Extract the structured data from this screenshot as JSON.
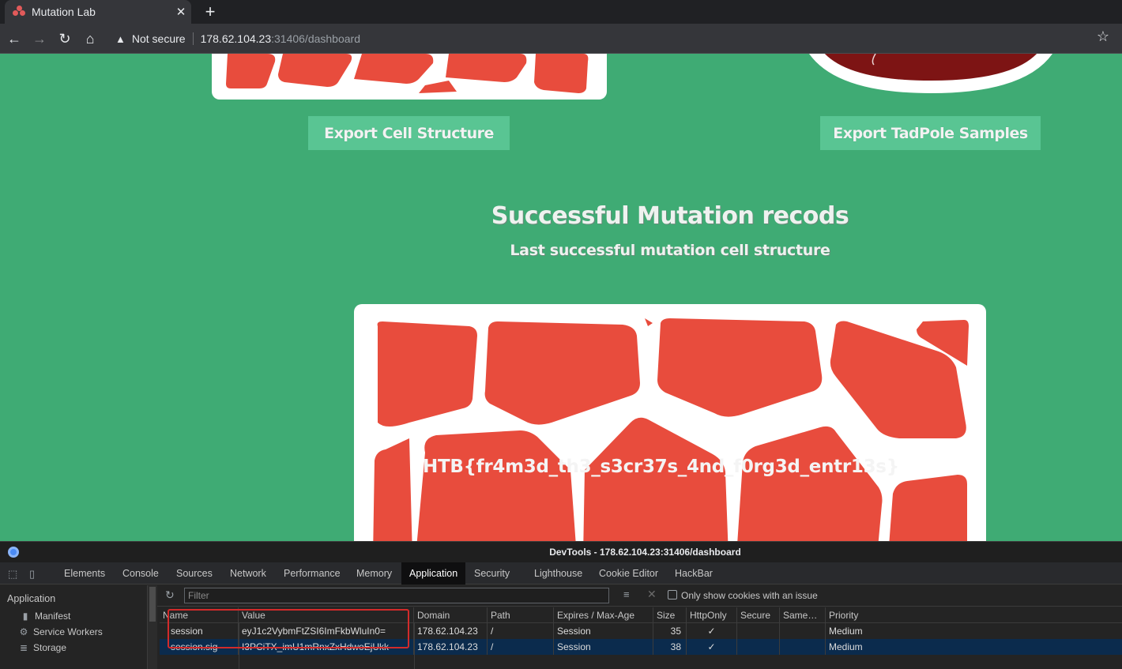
{
  "browser": {
    "tab_title": "Mutation Lab",
    "tab_close": "✕",
    "new_tab": "+",
    "not_secure": "Not secure",
    "url_host": "178.62.104.23",
    "url_rest": ":31406/dashboard"
  },
  "page": {
    "export_cell_label": "Export Cell Structure",
    "export_tadpole_label": "Export TadPole Samples",
    "records_title": "Successful Mutation recods",
    "records_subtitle": "Last successful mutation cell structure",
    "flag_text": "HTB{fr4m3d_th3_s3cr37s_4nd_f0rg3d_entr13s}",
    "colors": {
      "background": "#3fab74",
      "cell": "#e84c3d",
      "button": "#59c593"
    }
  },
  "devtools": {
    "title": "DevTools - 178.62.104.23:31406/dashboard",
    "tabs": [
      "Elements",
      "Console",
      "Sources",
      "Network",
      "Performance",
      "Memory",
      "Application",
      "Security",
      "Lighthouse",
      "Cookie Editor",
      "HackBar"
    ],
    "active_tab": "Application",
    "sidebar": {
      "heading": "Application",
      "items": [
        "Manifest",
        "Service Workers",
        "Storage"
      ]
    },
    "filter_placeholder": "Filter",
    "only_issues_label": "Only show cookies with an issue",
    "columns": [
      "Name",
      "Value",
      "Domain",
      "Path",
      "Expires / Max-Age",
      "Size",
      "HttpOnly",
      "Secure",
      "Same…",
      "Priority"
    ],
    "cookies": [
      {
        "name": "session",
        "value": "eyJ1c2VybmFtZSI6ImFkbWluIn0=",
        "domain": "178.62.104.23",
        "path": "/",
        "expires": "Session",
        "size": "35",
        "httponly": "✓",
        "secure": "",
        "samesite": "",
        "priority": "Medium"
      },
      {
        "name": "session.sig",
        "value": "I3PCiTX_imU1mRnxZxHdwoEjUkk",
        "domain": "178.62.104.23",
        "path": "/",
        "expires": "Session",
        "size": "38",
        "httponly": "✓",
        "secure": "",
        "samesite": "",
        "priority": "Medium"
      }
    ]
  }
}
